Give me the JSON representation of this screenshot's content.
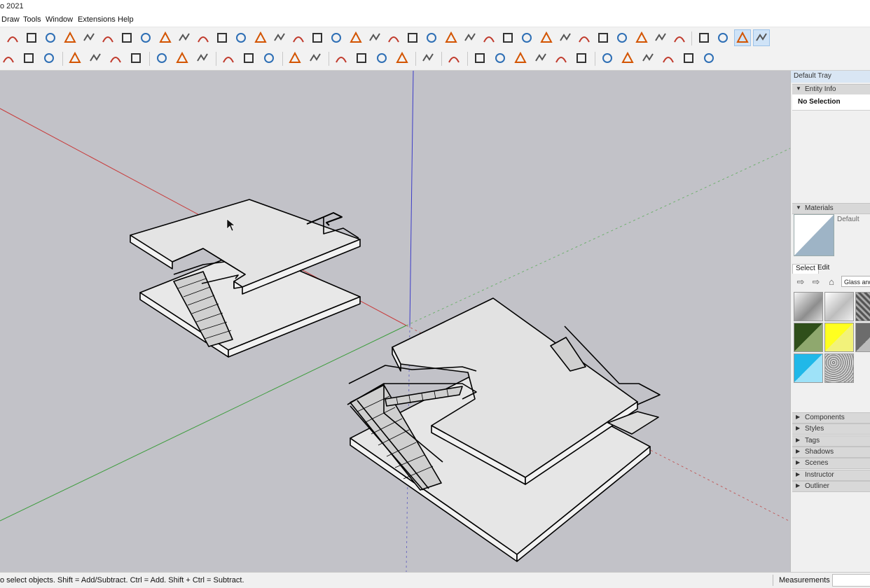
{
  "app": {
    "title": "o 2021"
  },
  "menu": [
    "Draw",
    "Tools",
    "Window",
    "Extensions",
    "Help"
  ],
  "colors": {
    "background": "#c2c2c8",
    "axis_red": "#c83c3c",
    "axis_green": "#3c9c3c",
    "axis_blue": "#3c3cc8",
    "face": "#e8e8e8",
    "edge": "#000000"
  },
  "toolbar1": {
    "icons": [
      "arc-icon",
      "pie-icon",
      "pencil-icon",
      "freehand-icon",
      "arc-alt-icon",
      "circle-icon",
      "polygon-icon",
      "bezier-icon",
      "corner-icon",
      "corner-alt-icon",
      "angle-icon",
      "curve-icon",
      "box-icon",
      "fan-icon",
      "spikes-icon",
      "mesh-icon",
      "hand-icon",
      "leaf-icon",
      "frustum-icon",
      "panels-icon",
      "slope-icon",
      "fold-icon",
      "fold-alt-icon",
      "arrow-icon",
      "stairs-icon",
      "wedge-icon",
      "step-icon",
      "blocks-icon",
      "lattice-icon",
      "grid-icon",
      "bars-icon",
      "gem-icon",
      "globe-icon",
      "wall-icon",
      "bush-icon",
      "sphere-icon",
      "axes-icon",
      "iso-view-icon",
      "front-view-icon",
      "right-view-icon"
    ]
  },
  "toolbar2": {
    "icons": [
      "select-icon",
      "eraser-icon",
      "paint-icon",
      "push-pull-icon",
      "follow-me-icon",
      "move-icon",
      "rotate-icon",
      "scale-icon",
      "tape-icon",
      "dimension-icon",
      "paint-bucket-icon",
      "orbit-icon",
      "pan-icon",
      "zoom-icon",
      "zoom-extents-icon",
      "sandbox-icon",
      "flip-icon",
      "layers-icon",
      "sections-icon",
      "user-icon",
      "undo-icon",
      "warehouse-icon",
      "door-icon",
      "house-icon",
      "roof-icon",
      "gable-icon",
      "open-icon",
      "solid-icon",
      "union-icon",
      "subtract-icon",
      "trim-icon",
      "split-icon",
      "outer-shell-icon"
    ]
  },
  "tray": {
    "title": "Default Tray",
    "entity_info": {
      "label": "Entity Info",
      "selection": "No Selection"
    },
    "materials": {
      "label": "Materials",
      "current": "Default",
      "tab_select": "Select",
      "tab_edit": "Edit",
      "library": "Glass and Mirrors"
    },
    "collapsed_panels": [
      "Components",
      "Styles",
      "Tags",
      "Shadows",
      "Scenes",
      "Instructor",
      "Outliner"
    ]
  },
  "status": {
    "hint": "o select objects. Shift = Add/Subtract. Ctrl = Add. Shift + Ctrl = Subtract.",
    "measurements_label": "Measurements",
    "measurements_value": ""
  }
}
